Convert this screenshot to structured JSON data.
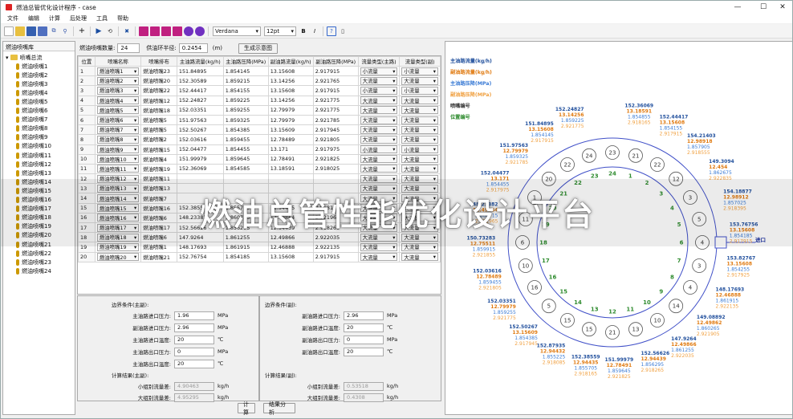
{
  "window": {
    "title": "燃油总管优化设计程序 - case",
    "controls": [
      "—",
      "☐",
      "✕"
    ]
  },
  "menu": [
    "文件",
    "编辑",
    "计算",
    "后处理",
    "工具",
    "帮助"
  ],
  "toolbar": {
    "font": "Verdana",
    "size": "12pt",
    "bold": "B",
    "italic": "I",
    "help": "?"
  },
  "tree": {
    "header": "燃油喷嘴库",
    "root": "喷嘴总流",
    "items": [
      "燃油喷嘴1",
      "燃油喷嘴2",
      "燃油喷嘴3",
      "燃油喷嘴4",
      "燃油喷嘴5",
      "燃油喷嘴6",
      "燃油喷嘴7",
      "燃油喷嘴8",
      "燃油喷嘴9",
      "燃油喷嘴10",
      "燃油喷嘴11",
      "燃油喷嘴12",
      "燃油喷嘴13",
      "燃油喷嘴14",
      "燃油喷嘴15",
      "燃油喷嘴16",
      "燃油喷嘴17",
      "燃油喷嘴18",
      "燃油喷嘴19",
      "燃油喷嘴20",
      "燃油喷嘴21",
      "燃油喷嘴22",
      "燃油喷嘴23",
      "燃油喷嘴24"
    ]
  },
  "controls": {
    "count_label": "燃油喷嘴数量:",
    "count_value": "24",
    "radius_label": "供油环半径:",
    "radius_value": "0.2454",
    "radius_unit": "(m)",
    "gen_button": "生成示意图"
  },
  "grid": {
    "headers": [
      "位置",
      "喷嘴名称",
      "喷嘴排布",
      "主油路流量(kg/h)",
      "主油路压降(MPa)",
      "副油路流量(kg/h)",
      "副油路压降(MPa)",
      "流量类型(主路)",
      "流量类型(副)"
    ],
    "rows": [
      [
        "1",
        "燃油喷嘴1",
        "燃油喷嘴23",
        "151.84895",
        "1.854145",
        "13.15608",
        "2.917915",
        "小流量",
        "小流量"
      ],
      [
        "2",
        "燃油喷嘴2",
        "燃油喷嘴20",
        "152.30589",
        "1.859215",
        "13.14256",
        "2.921765",
        "大流量",
        "大流量"
      ],
      [
        "3",
        "燃油喷嘴3",
        "燃油喷嘴22",
        "152.44417",
        "1.854155",
        "13.15608",
        "2.917915",
        "小流量",
        "小流量"
      ],
      [
        "4",
        "燃油喷嘴4",
        "燃油喷嘴12",
        "152.24827",
        "1.859225",
        "13.14256",
        "2.921775",
        "大流量",
        "大流量"
      ],
      [
        "5",
        "燃油喷嘴5",
        "燃油喷嘴18",
        "152.03351",
        "1.859255",
        "12.79979",
        "2.921775",
        "大流量",
        "大流量"
      ],
      [
        "6",
        "燃油喷嘴6",
        "燃油喷嘴5",
        "151.97563",
        "1.859325",
        "12.79979",
        "2.921785",
        "大流量",
        "大流量"
      ],
      [
        "7",
        "燃油喷嘴7",
        "燃油喷嘴5",
        "152.50267",
        "1.854385",
        "13.15609",
        "2.917945",
        "大流量",
        "大流量"
      ],
      [
        "8",
        "燃油喷嘴8",
        "燃油喷嘴2",
        "152.03616",
        "1.859455",
        "12.78489",
        "2.921805",
        "大流量",
        "大流量"
      ],
      [
        "9",
        "燃油喷嘴9",
        "燃油喷嘴15",
        "152.04477",
        "1.854455",
        "13.171",
        "2.917975",
        "小流量",
        "小流量"
      ],
      [
        "10",
        "燃油喷嘴10",
        "燃油喷嘴4",
        "151.99979",
        "1.859645",
        "12.78491",
        "2.921825",
        "大流量",
        "大流量"
      ],
      [
        "11",
        "燃油喷嘴11",
        "燃油喷嘴19",
        "152.36069",
        "1.854585",
        "13.18591",
        "2.918025",
        "大流量",
        "大流量"
      ],
      [
        "12",
        "燃油喷嘴12",
        "燃油喷嘴11",
        "",
        "",
        "",
        "",
        "大流量",
        "大流量"
      ],
      [
        "13",
        "燃油喷嘴13",
        "燃油喷嘴13",
        "",
        "",
        "",
        "",
        "大流量",
        "大流量"
      ],
      [
        "14",
        "燃油喷嘴14",
        "燃油喷嘴7",
        "",
        "",
        "",
        "",
        "大流量",
        "大流量"
      ],
      [
        "15",
        "燃油喷嘴15",
        "燃油喷嘴16",
        "152.38559",
        "1.855705",
        "12.94435",
        "2.918165",
        "大流量",
        "大流量"
      ],
      [
        "16",
        "燃油喷嘴16",
        "燃油喷嘴6",
        "148.23382",
        "1.860715",
        "12.49864",
        "2.921965",
        "大流量",
        "大流量"
      ],
      [
        "17",
        "燃油喷嘴17",
        "燃油喷嘴17",
        "152.56626",
        "1.856295",
        "12.94439",
        "2.918265",
        "大流量",
        "大流量"
      ],
      [
        "18",
        "燃油喷嘴18",
        "燃油喷嘴6",
        "147.9264",
        "1.861255",
        "12.49866",
        "2.922035",
        "大流量",
        "大流量"
      ],
      [
        "19",
        "燃油喷嘴19",
        "燃油喷嘴1",
        "148.17693",
        "1.861915",
        "12.46888",
        "2.922135",
        "大流量",
        "大流量"
      ],
      [
        "20",
        "燃油喷嘴20",
        "燃油喷嘴21",
        "152.76754",
        "1.854185",
        "13.15608",
        "2.917915",
        "大流量",
        "大流量"
      ]
    ]
  },
  "main_bc": {
    "title": "边界条件(主副):",
    "rows": [
      {
        "label": "主油路进口压力:",
        "value": "1.96",
        "unit": "MPa"
      },
      {
        "label": "副油路进口压力:",
        "value": "2.96",
        "unit": "MPa"
      },
      {
        "label": "主油路进口温度:",
        "value": "20",
        "unit": "℃"
      },
      {
        "label": "主油路出口压力:",
        "value": "0",
        "unit": "MPa"
      },
      {
        "label": "主油路出口温度:",
        "value": "20",
        "unit": "℃"
      }
    ],
    "result_title": "计算结果(主副):",
    "results": [
      {
        "label": "小组别流量差:",
        "value": "4.90463",
        "unit": "kg/h"
      },
      {
        "label": "大组别流量差:",
        "value": "4.95295",
        "unit": "kg/h"
      }
    ]
  },
  "sub_bc": {
    "title": "边界条件(副):",
    "rows": [
      {
        "label": "副油路进口压力:",
        "value": "2.96",
        "unit": "MPa"
      },
      {
        "label": "副油路进口温度:",
        "value": "20",
        "unit": "℃"
      },
      {
        "label": "副油路出口压力:",
        "value": "0",
        "unit": "MPa"
      },
      {
        "label": "副油路出口温度:",
        "value": "20",
        "unit": "℃"
      }
    ],
    "result_title": "计算结果(副):",
    "results": [
      {
        "label": "小组别流量差:",
        "value": "0.53518",
        "unit": "kg/h"
      },
      {
        "label": "大组别流量差:",
        "value": "0.4308",
        "unit": "kg/h"
      }
    ]
  },
  "actions": {
    "calc": "计算",
    "analysis": "结果分析"
  },
  "legend": [
    {
      "text": "主油路流量(kg/h)",
      "color": "#1f4e9c"
    },
    {
      "text": "副油路流量(kg/h)",
      "color": "#e07a10"
    },
    {
      "text": "主油路压降(MPa)",
      "color": "#3a7bd5"
    },
    {
      "text": "副油路压降(MPa)",
      "color": "#f0a040"
    },
    {
      "text": "喷嘴编号",
      "color": "#333333"
    },
    {
      "text": "位置编号",
      "color": "#2e8b2e"
    }
  ],
  "inlet_label": "进口",
  "nozzle_circles": [
    {
      "pos": "1",
      "nozzle": "21"
    },
    {
      "pos": "2",
      "nozzle": "22"
    },
    {
      "pos": "3",
      "nozzle": "12"
    },
    {
      "pos": "4",
      "nozzle": "3"
    },
    {
      "pos": "5",
      "nozzle": "5"
    },
    {
      "pos": "6",
      "nozzle": "4"
    },
    {
      "pos": "7",
      "nozzle": "3"
    },
    {
      "pos": "8",
      "nozzle": "4"
    },
    {
      "pos": "9",
      "nozzle": "14"
    },
    {
      "pos": "10",
      "nozzle": "10"
    },
    {
      "pos": "11",
      "nozzle": "13"
    },
    {
      "pos": "12",
      "nozzle": "21"
    },
    {
      "pos": "13",
      "nozzle": "15"
    },
    {
      "pos": "14",
      "nozzle": "15"
    },
    {
      "pos": "15",
      "nozzle": "5"
    },
    {
      "pos": "16",
      "nozzle": "16"
    },
    {
      "pos": "17",
      "nozzle": "10"
    },
    {
      "pos": "18",
      "nozzle": "6"
    },
    {
      "pos": "19",
      "nozzle": "11"
    },
    {
      "pos": "20",
      "nozzle": "1"
    },
    {
      "pos": "21",
      "nozzle": "20"
    },
    {
      "pos": "22",
      "nozzle": "22"
    },
    {
      "pos": "23",
      "nozzle": "24"
    },
    {
      "pos": "24",
      "nozzle": "23"
    }
  ],
  "nozzle_labels": [
    {
      "id": "l1",
      "v": [
        "152.36069",
        "13.18591",
        "1.854855",
        "2.918165"
      ]
    },
    {
      "id": "l2",
      "v": [
        "152.44417",
        "13.15608",
        "1.854155",
        "2.917915"
      ]
    },
    {
      "id": "l3",
      "v": [
        "154.21403",
        "12.98918",
        "1.857905",
        "2.918555"
      ]
    },
    {
      "id": "l4",
      "v": [
        "149.3094",
        "12.454",
        "1.862675",
        "2.922835"
      ]
    },
    {
      "id": "l5",
      "v": [
        "154.18877",
        "12.98912",
        "1.857025",
        "2.918395"
      ]
    },
    {
      "id": "l6",
      "v": [
        "153.76756",
        "13.15608",
        "1.854185",
        "2.917915"
      ]
    },
    {
      "id": "l7",
      "v": [
        "153.82767",
        "13.15608",
        "1.854255",
        "2.917925"
      ]
    },
    {
      "id": "l8",
      "v": [
        "148.17693",
        "12.46888",
        "1.861915",
        "2.922135"
      ]
    },
    {
      "id": "l9",
      "v": [
        "149.08892",
        "12.49862",
        "1.860265",
        "2.921905"
      ]
    },
    {
      "id": "l10",
      "v": [
        "147.9264",
        "12.49866",
        "1.861255",
        "2.922035"
      ]
    },
    {
      "id": "l11",
      "v": [
        "152.56626",
        "12.94439",
        "1.856295",
        "2.918265"
      ]
    },
    {
      "id": "l12",
      "v": [
        "151.99979",
        "12.78491",
        "1.859645",
        "2.921825"
      ]
    },
    {
      "id": "l13",
      "v": [
        "152.38559",
        "12.94435",
        "1.855705",
        "2.918165"
      ]
    },
    {
      "id": "l14",
      "v": [
        "152.87935",
        "12.94432",
        "1.855225",
        "2.918085"
      ]
    },
    {
      "id": "l15",
      "v": [
        "152.50267",
        "13.15609",
        "1.854385",
        "2.917945"
      ]
    },
    {
      "id": "l16",
      "v": [
        "152.03351",
        "12.79979",
        "1.859255",
        "2.921775"
      ]
    },
    {
      "id": "l17",
      "v": [
        "152.03616",
        "12.78489",
        "1.859455",
        "2.921805"
      ]
    },
    {
      "id": "l18",
      "v": [
        "150.73283",
        "12.75511",
        "1.859915",
        "2.921855"
      ]
    },
    {
      "id": "l19",
      "v": [
        "148.23382",
        "12.49864",
        "1.860715",
        "2.921965"
      ]
    },
    {
      "id": "l20",
      "v": [
        "152.04477",
        "13.171",
        "1.854455",
        "2.917975"
      ]
    },
    {
      "id": "l21",
      "v": [
        "151.97563",
        "12.79979",
        "1.859325",
        "2.921785"
      ]
    },
    {
      "id": "l22",
      "v": [
        "151.84895",
        "13.15608",
        "1.854145",
        "2.917915"
      ]
    },
    {
      "id": "l23",
      "v": [
        "152.24827",
        "13.14256",
        "1.859225",
        "2.921775"
      ]
    }
  ],
  "overlay": "燃油总管性能优化设计平台"
}
